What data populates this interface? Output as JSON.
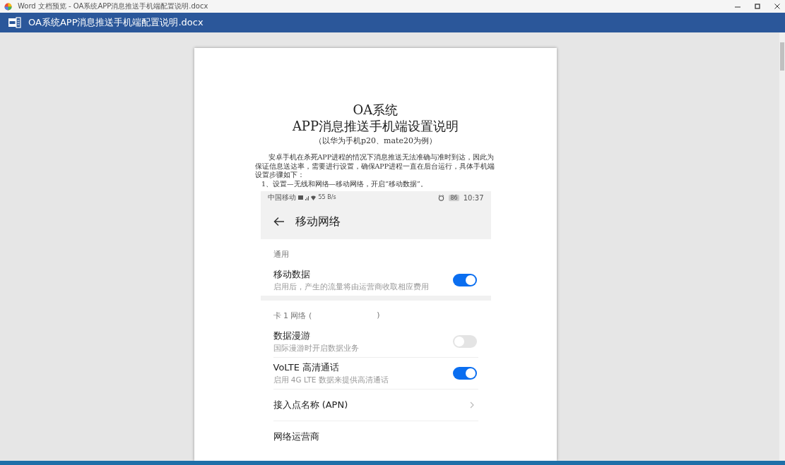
{
  "window": {
    "title": "Word 文档预览 - OA系统APP消息推送手机端配置说明.docx"
  },
  "app_bar": {
    "file_name": "OA系统APP消息推送手机端配置说明.docx"
  },
  "document": {
    "title_lines": [
      "OA系统",
      "APP消息推送手机端设置说明"
    ],
    "subtitle": "（以华为手机p20、mate20为例）",
    "intro": "安卓手机在杀死APP进程的情况下消息推送无法准确与准时到达，因此为保证信息送达率，需要进行设置，确保APP进程一直在后台运行，具体手机端设置步骤如下：",
    "step": "1、设置—无线和网络—移动网络，开启“移动数据”。",
    "phone": {
      "status_bar": {
        "carrier": "中国移动",
        "speed": "55",
        "speed_unit": "B/s",
        "battery": "86",
        "time": "10:37"
      },
      "header": {
        "title": "移动网络"
      },
      "sections": [
        {
          "title": "通用",
          "items": [
            {
              "kind": "toggle",
              "title": "移动数据",
              "subtitle": "启用后，产生的流量将由运营商收取相应费用",
              "on": true
            }
          ]
        },
        {
          "title": "卡 1 网络 (",
          "title_end": ")",
          "items": [
            {
              "kind": "toggle",
              "title": "数据漫游",
              "subtitle": "国际漫游时开启数据业务",
              "on": false
            },
            {
              "kind": "toggle",
              "title": "VoLTE 高清通话",
              "subtitle": "启用 4G LTE 数据来提供高清通话",
              "on": true
            },
            {
              "kind": "link",
              "title": "接入点名称 (APN)"
            },
            {
              "kind": "plain",
              "title": "网络运营商"
            }
          ]
        }
      ]
    }
  }
}
